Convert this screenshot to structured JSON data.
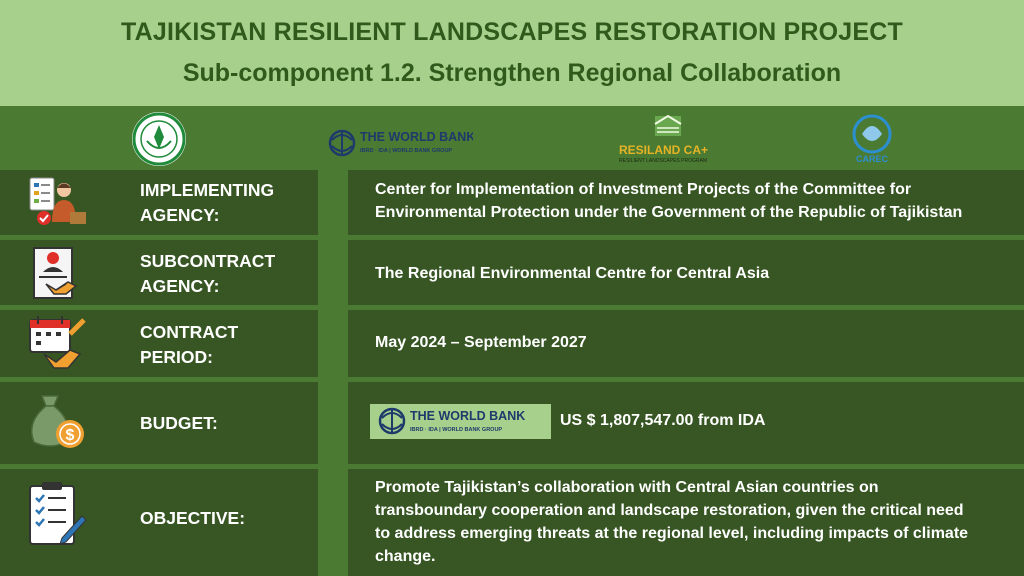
{
  "header": {
    "title": "TAJIKISTAN RESILIENT LANDSCAPES RESTORATION PROJECT",
    "subtitle": "Sub-component 1.2. Strengthen Regional Collaboration"
  },
  "logos": {
    "world_bank": {
      "name": "THE WORLD BANK",
      "tagline": "IBRD · IDA | WORLD BANK GROUP"
    },
    "resiland": {
      "name": "RESILAND CA+",
      "tagline": "RESILIENT LANDSCAPES PROGRAM"
    },
    "carec": {
      "name": "CAREC"
    }
  },
  "rows": [
    {
      "label_line1": "IMPLEMENTING",
      "label_line2": "AGENCY:",
      "value_line1": "Center for Implementation of Investment Projects of the Committee for",
      "value_line2": "Environmental Protection under the Government of the Republic of Tajikistan"
    },
    {
      "label_line1": "SUBCONTRACT",
      "label_line2": "AGENCY:",
      "value": "The Regional Environmental Centre for Central Asia"
    },
    {
      "label_line1": "CONTRACT",
      "label_line2": "PERIOD:",
      "value": "May 2024 – September 2027"
    },
    {
      "label": "BUDGET:",
      "value": "US $ 1,807,547.00 from IDA"
    },
    {
      "label": "OBJECTIVE:",
      "value_line1": "Promote Tajikistan’s collaboration with Central Asian countries on",
      "value_line2": "transboundary cooperation and landscape restoration, given the critical need",
      "value_line3": "to address emerging threats at the regional level, including impacts of climate",
      "value_line4": "change."
    }
  ],
  "colors": {
    "header_bg": "#a8d08d",
    "title_text": "#2f5a1c",
    "page_bg": "#4b7a33",
    "row_bg": "#375623"
  },
  "icons": [
    "manager-icon",
    "contract-handshake-icon",
    "calendar-handshake-icon",
    "money-bag-icon",
    "checklist-icon"
  ]
}
